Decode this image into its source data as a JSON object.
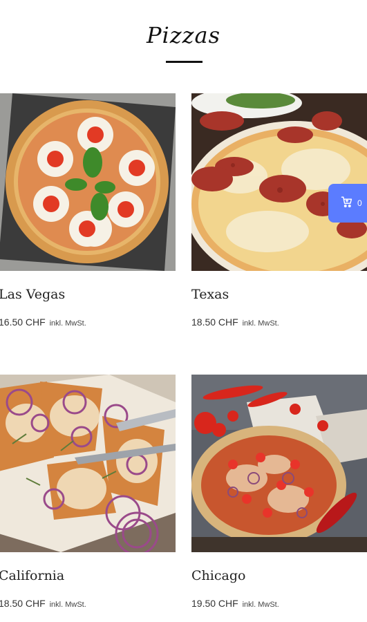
{
  "header": {
    "title": "Pizzas"
  },
  "products": [
    {
      "name": "Las Vegas",
      "price": "16.50 CHF",
      "vat": "inkl. MwSt."
    },
    {
      "name": "Texas",
      "price": "18.50 CHF",
      "vat": "inkl. MwSt."
    },
    {
      "name": "California",
      "price": "18.50 CHF",
      "vat": "inkl. MwSt."
    },
    {
      "name": "Chicago",
      "price": "19.50 CHF",
      "vat": "inkl. MwSt."
    }
  ],
  "cart": {
    "count": "0",
    "icon": "shopping-cart-icon",
    "color": "#5b7cff"
  }
}
